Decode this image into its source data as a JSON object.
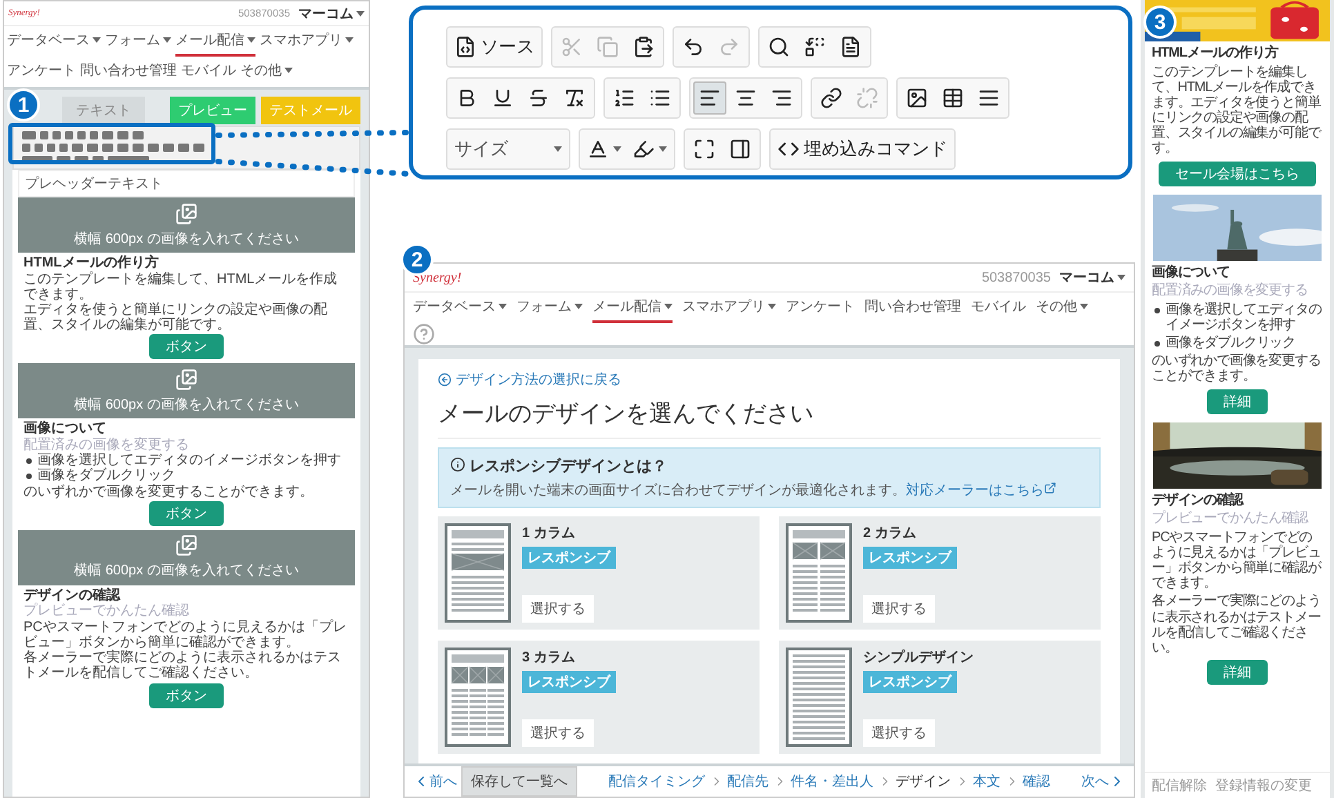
{
  "badges": [
    "1",
    "2",
    "3"
  ],
  "editor": {
    "logo": "Synergy!",
    "account_id": "503870035",
    "account_name": "マーコム",
    "nav": [
      {
        "label": "データベース",
        "dropdown": true,
        "selected": false
      },
      {
        "label": "フォーム",
        "dropdown": true,
        "selected": false
      },
      {
        "label": "メール配信",
        "dropdown": true,
        "selected": true
      },
      {
        "label": "スマホアプリ",
        "dropdown": true,
        "selected": false
      },
      {
        "label": "アンケート",
        "dropdown": false,
        "selected": false
      },
      {
        "label": "問い合わせ管理",
        "dropdown": false,
        "selected": false
      },
      {
        "label": "モバイル",
        "dropdown": false,
        "selected": false
      },
      {
        "label": "その他",
        "dropdown": true,
        "selected": false
      }
    ],
    "tab": "テキスト",
    "preview_button": "プレビュー",
    "test_mail_button": "テストメール",
    "preheader": "プレヘッダーテキスト",
    "sections": [
      {
        "image_hint": "横幅 600px の画像を入れてください",
        "heading": "HTMLメールの作り方",
        "paragraphs": [
          "このテンプレートを編集して、HTMLメールを作成できます。",
          "エディタを使うと簡単にリンクの設定や画像の配置、スタイルの編集が可能です。"
        ],
        "button": "ボタン"
      },
      {
        "image_hint": "横幅 600px の画像を入れてください",
        "heading": "画像について",
        "subheading": "配置済みの画像を変更する",
        "bullets": [
          "画像を選択してエディタのイメージボタンを押す",
          "画像をダブルクリック"
        ],
        "paragraphs": [
          "のいずれかで画像を変更することができます。"
        ],
        "button": "ボタン"
      },
      {
        "image_hint": "横幅 600px の画像を入れてください",
        "heading": "デザインの確認",
        "subheading": "プレビューでかんたん確認",
        "paragraphs": [
          "PCやスマートフォンでどのように見えるかは「プレビュー」ボタンから簡単に確認ができます。",
          "各メーラーで実際にどのように表示されるかはテストメールを配信してご確認ください。"
        ],
        "button": "ボタン"
      }
    ]
  },
  "toolbar": {
    "rows": [
      [
        [
          {
            "kind": "source",
            "label": "ソース"
          }
        ],
        [
          {
            "kind": "icon",
            "disabled": true,
            "selected": false
          },
          {
            "kind": "icon",
            "disabled": true,
            "selected": false
          },
          {
            "kind": "icon",
            "disabled": false,
            "selected": false
          }
        ],
        [
          {
            "kind": "icon",
            "disabled": false,
            "selected": false
          },
          {
            "kind": "icon",
            "disabled": true,
            "selected": false
          }
        ],
        [
          {
            "kind": "icon",
            "disabled": false,
            "selected": false
          },
          {
            "kind": "icon",
            "disabled": false,
            "selected": false
          },
          {
            "kind": "icon",
            "disabled": false,
            "selected": false
          }
        ]
      ],
      [
        [
          {
            "kind": "icon",
            "disabled": false,
            "selected": false
          },
          {
            "kind": "icon",
            "disabled": false,
            "selected": false
          },
          {
            "kind": "icon",
            "disabled": false,
            "selected": false
          },
          {
            "kind": "icon",
            "disabled": false,
            "selected": false
          }
        ],
        [
          {
            "kind": "icon",
            "disabled": false,
            "selected": false
          },
          {
            "kind": "icon",
            "disabled": false,
            "selected": false
          }
        ],
        [
          {
            "kind": "icon",
            "disabled": false,
            "selected": true
          },
          {
            "kind": "icon",
            "disabled": false,
            "selected": false
          },
          {
            "kind": "icon",
            "disabled": false,
            "selected": false
          }
        ],
        [
          {
            "kind": "icon",
            "disabled": false,
            "selected": false
          },
          {
            "kind": "icon",
            "disabled": true,
            "selected": false
          }
        ],
        [
          {
            "kind": "icon",
            "disabled": false,
            "selected": false
          },
          {
            "kind": "icon",
            "disabled": false,
            "selected": false
          },
          {
            "kind": "icon",
            "disabled": false,
            "selected": false
          }
        ]
      ],
      [
        [
          {
            "kind": "select",
            "placeholder": "サイズ"
          }
        ],
        [
          {
            "kind": "color"
          },
          {
            "kind": "color"
          }
        ],
        [
          {
            "kind": "icon",
            "disabled": false,
            "selected": false
          },
          {
            "kind": "icon",
            "disabled": false,
            "selected": false
          }
        ],
        [
          {
            "kind": "embed",
            "label": "埋め込みコマンド"
          }
        ]
      ]
    ]
  },
  "designer": {
    "logo": "Synergy!",
    "account_id": "503870035",
    "account_name": "マーコム",
    "nav": [
      {
        "label": "データベース",
        "dropdown": true,
        "selected": false
      },
      {
        "label": "フォーム",
        "dropdown": true,
        "selected": false
      },
      {
        "label": "メール配信",
        "dropdown": true,
        "selected": true
      },
      {
        "label": "スマホアプリ",
        "dropdown": true,
        "selected": false
      },
      {
        "label": "アンケート",
        "dropdown": false,
        "selected": false
      },
      {
        "label": "問い合わせ管理",
        "dropdown": false,
        "selected": false
      },
      {
        "label": "モバイル",
        "dropdown": false,
        "selected": false
      },
      {
        "label": "その他",
        "dropdown": true,
        "selected": false
      }
    ],
    "back_link": "デザイン方法の選択に戻る",
    "title": "メールのデザインを選んでください",
    "info": {
      "title": "レスポンシブデザインとは？",
      "text": "メールを開いた端末の画面サイズに合わせてデザインが最適化されます。",
      "link": "対応メーラーはこちら"
    },
    "templates": [
      {
        "kind": "one",
        "name": "1 カラム",
        "badge": "レスポンシブ",
        "button": "選択する"
      },
      {
        "kind": "two",
        "name": "2 カラム",
        "badge": "レスポンシブ",
        "button": "選択する"
      },
      {
        "kind": "three",
        "name": "3 カラム",
        "badge": "レスポンシブ",
        "button": "選択する"
      },
      {
        "kind": "simple",
        "name": "シンプルデザイン",
        "badge": "レスポンシブ",
        "button": "選択する"
      }
    ],
    "footer": {
      "prev": "前へ",
      "save": "保存して一覧へ",
      "next": "次へ",
      "steps": [
        {
          "label": "配信タイミング",
          "selected": false
        },
        {
          "label": "配信先",
          "selected": false
        },
        {
          "label": "件名・差出人",
          "selected": false
        },
        {
          "label": "デザイン",
          "selected": true
        },
        {
          "label": "本文",
          "selected": false
        },
        {
          "label": "確認",
          "selected": false
        }
      ]
    }
  },
  "mobile": {
    "sections": [
      {
        "heading": "HTMLメールの作り方",
        "paragraphs": [
          "このテンプレートを編集して、HTMLメールを作成できます。エディタを使うと簡単にリンクの設定や画像の配置、スタイルの編集が可能です。"
        ],
        "button": "セール会場はこちら"
      },
      {
        "heading": "画像について",
        "subheading": "配置済みの画像を変更する",
        "bullets": [
          "画像を選択してエディタのイメージボタンを押す",
          "画像をダブルクリック"
        ],
        "paragraphs": [
          "のいずれかで画像を変更することができます。"
        ],
        "button": "詳細"
      },
      {
        "heading": "デザインの確認",
        "subheading": "プレビューでかんたん確認",
        "paragraphs": [
          "PCやスマートフォンでどのように見えるかは「プレビュー」ボタンから簡単に確認ができます。",
          "各メーラーで実際にどのように表示されるかはテストメールを配信してご確認ください。"
        ],
        "button": "詳細"
      }
    ],
    "footer": [
      "配信解除",
      "登録情報の変更"
    ]
  }
}
